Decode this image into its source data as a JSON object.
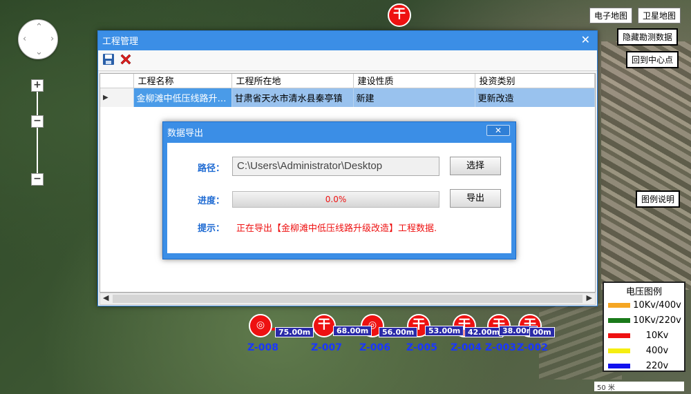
{
  "map": {
    "btn_electronic": "电子地图",
    "btn_satellite": "卫星地图",
    "btn_hide_survey": "隐藏勘测数据",
    "btn_back_center": "回到中心点",
    "btn_legend_info": "图例说明",
    "zoom_in": "+",
    "zoom_out": "−",
    "zoom_mid": "−",
    "scale": "50 米",
    "top_pole_glyph": "干"
  },
  "legend": {
    "title": "电压图例",
    "items": [
      {
        "label": "10Kv/400v",
        "color": "#f5a623"
      },
      {
        "label": "10Kv/220v",
        "color": "#1a7a1a"
      },
      {
        "label": "10Kv",
        "color": "#ee1111"
      },
      {
        "label": "400v",
        "color": "#f5ee11"
      },
      {
        "label": "220v",
        "color": "#1111ee"
      }
    ]
  },
  "poles": [
    {
      "label": "Z-008",
      "glyph": "◎"
    },
    {
      "label": "Z-007",
      "glyph": "干"
    },
    {
      "label": "Z-006",
      "glyph": "◎"
    },
    {
      "label": "Z-005",
      "glyph": "干"
    },
    {
      "label": "Z-004",
      "glyph": "干"
    },
    {
      "label": "Z-003",
      "glyph": "干"
    },
    {
      "label": "Z-002",
      "glyph": "干"
    }
  ],
  "distances": [
    "75.00m",
    "68.00m",
    "56.00m",
    "53.00m",
    "42.00m",
    "38.00m",
    "00m"
  ],
  "project_window": {
    "title": "工程管理",
    "close": "✕",
    "columns": [
      "工程名称",
      "工程所在地",
      "建设性质",
      "投资类别"
    ],
    "row": {
      "marker": "▶",
      "name": "金柳滩中低压线路升级改造",
      "location": "甘肃省天水市清水县秦亭镇",
      "nature": "新建",
      "investment": "更新改造"
    },
    "scroll_left": "◀",
    "scroll_right": "▶"
  },
  "export_dialog": {
    "title": "数据导出",
    "close": "✕",
    "path_label": "路径：",
    "path_value": "C:\\Users\\Administrator\\Desktop",
    "select_button": "选择",
    "progress_label": "进度：",
    "progress_text": "0.0%",
    "progress_value": 0.0,
    "export_button": "导出",
    "hint_label": "提示：",
    "hint_text": "正在导出【金柳滩中低压线路升级改造】工程数据."
  }
}
